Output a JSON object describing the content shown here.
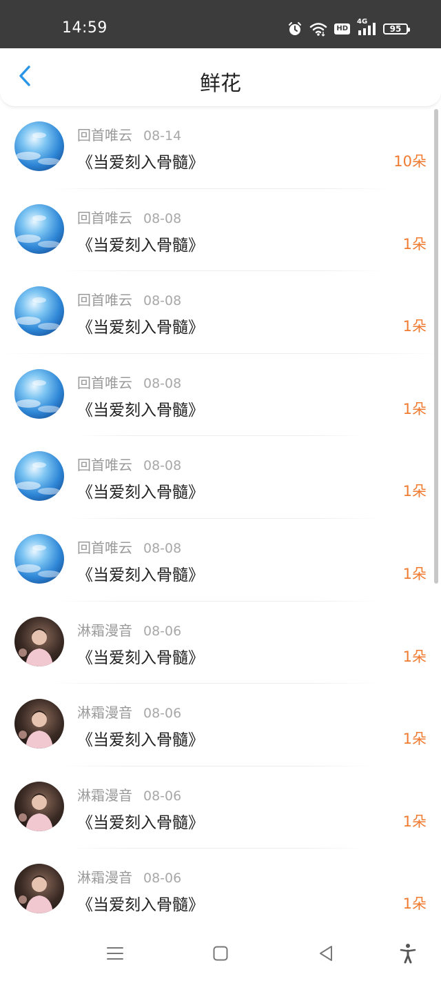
{
  "status_bar": {
    "time": "14:59",
    "hd": "HD",
    "network": "4G",
    "battery": "95",
    "icons": [
      "alarm-icon",
      "wifi-icon",
      "hd-icon",
      "signal-icon",
      "battery-icon"
    ]
  },
  "header": {
    "title": "鲜花",
    "back_icon": "chevron-left-icon"
  },
  "colors": {
    "accent_blue": "#2b96e6",
    "count_orange": "#f07a2f",
    "status_bar_bg": "#3c3c3c"
  },
  "items": [
    {
      "user": "回首唯云",
      "date": "08-14",
      "book": "《当爱刻入骨髓》",
      "count": "10朵",
      "avatar": "sky-avatar"
    },
    {
      "user": "回首唯云",
      "date": "08-08",
      "book": "《当爱刻入骨髓》",
      "count": "1朵",
      "avatar": "sky-avatar"
    },
    {
      "user": "回首唯云",
      "date": "08-08",
      "book": "《当爱刻入骨髓》",
      "count": "1朵",
      "avatar": "sky-avatar"
    },
    {
      "user": "回首唯云",
      "date": "08-08",
      "book": "《当爱刻入骨髓》",
      "count": "1朵",
      "avatar": "sky-avatar"
    },
    {
      "user": "回首唯云",
      "date": "08-08",
      "book": "《当爱刻入骨髓》",
      "count": "1朵",
      "avatar": "sky-avatar"
    },
    {
      "user": "回首唯云",
      "date": "08-08",
      "book": "《当爱刻入骨髓》",
      "count": "1朵",
      "avatar": "sky-avatar"
    },
    {
      "user": "淋霜漫音",
      "date": "08-06",
      "book": "《当爱刻入骨髓》",
      "count": "1朵",
      "avatar": "person-avatar"
    },
    {
      "user": "淋霜漫音",
      "date": "08-06",
      "book": "《当爱刻入骨髓》",
      "count": "1朵",
      "avatar": "person-avatar"
    },
    {
      "user": "淋霜漫音",
      "date": "08-06",
      "book": "《当爱刻入骨髓》",
      "count": "1朵",
      "avatar": "person-avatar"
    },
    {
      "user": "淋霜漫音",
      "date": "08-06",
      "book": "《当爱刻入骨髓》",
      "count": "1朵",
      "avatar": "person-avatar"
    }
  ],
  "nav_bar": {
    "buttons": [
      "menu-icon",
      "home-square-icon",
      "back-triangle-icon",
      "accessibility-icon"
    ]
  }
}
